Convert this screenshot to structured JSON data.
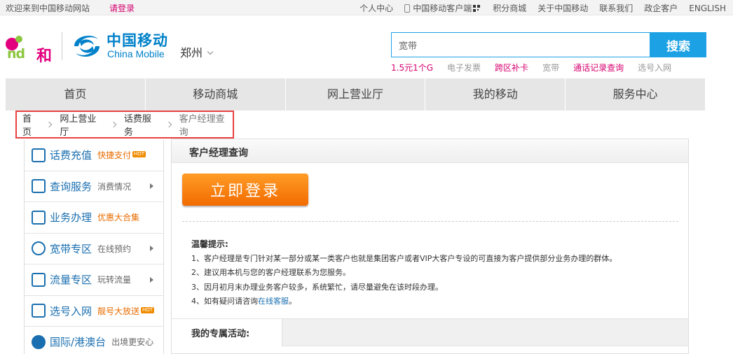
{
  "topbar": {
    "welcome": "欢迎来到中国移动网站",
    "login": "请登录",
    "links": [
      "个人中心",
      "中国移动客户端",
      "积分商城",
      "关于中国移动",
      "联系我们",
      "政企客户",
      "ENGLISH"
    ]
  },
  "header": {
    "logo_he": "和",
    "logo_cn": "中国移动",
    "logo_en": "China Mobile",
    "city": "郑州",
    "search": {
      "value": "宽带",
      "button": "搜索"
    },
    "hotwords": [
      "1.5元1个G",
      "电子发票",
      "跨区补卡",
      "宽带",
      "通话记录查询",
      "选号入网"
    ]
  },
  "nav": [
    "首页",
    "移动商城",
    "网上营业厅",
    "我的移动",
    "服务中心"
  ],
  "breadcrumb": [
    "首页",
    "网上营业厅",
    "话费服务",
    "客户经理查询"
  ],
  "sidebar": [
    {
      "name": "话费充值",
      "sub": "快捷支付",
      "hot": "HOT",
      "icon": "yuan-icon"
    },
    {
      "name": "查询服务",
      "sub": "消费情况",
      "icon": "search-doc-icon"
    },
    {
      "name": "业务办理",
      "sub": "优惠大合集",
      "icon": "business-icon"
    },
    {
      "name": "宽带专区",
      "sub": "在线预约",
      "icon": "wifi-icon"
    },
    {
      "name": "流量专区",
      "sub": "玩转流量",
      "icon": "data-chart-icon"
    },
    {
      "name": "选号入网",
      "sub": "靓号大放送",
      "hot": "HOT",
      "icon": "sim-icon"
    },
    {
      "name": "国际/港澳台",
      "sub": "出境更安心",
      "icon": "globe-icon"
    }
  ],
  "content": {
    "title": "客户经理查询",
    "login_button": "立即登录",
    "tips_title": "温馨提示:",
    "tips": [
      "1、客户经理是专门针对某一部分或某一类客户也就是集团客户或者VIP大客户专设的可直接为客户提供部分业务办理的群体。",
      "2、建议用本机与您的客户经理联系为您服务。",
      "3、因月初月末办理业务客户较多，系统繁忙，请尽量避免在该时段办理。"
    ],
    "tip4_prefix": "4、如有疑问请咨询",
    "tip4_link": "在线客服",
    "tip4_suffix": "。",
    "activity_title": "我的专属活动:"
  }
}
